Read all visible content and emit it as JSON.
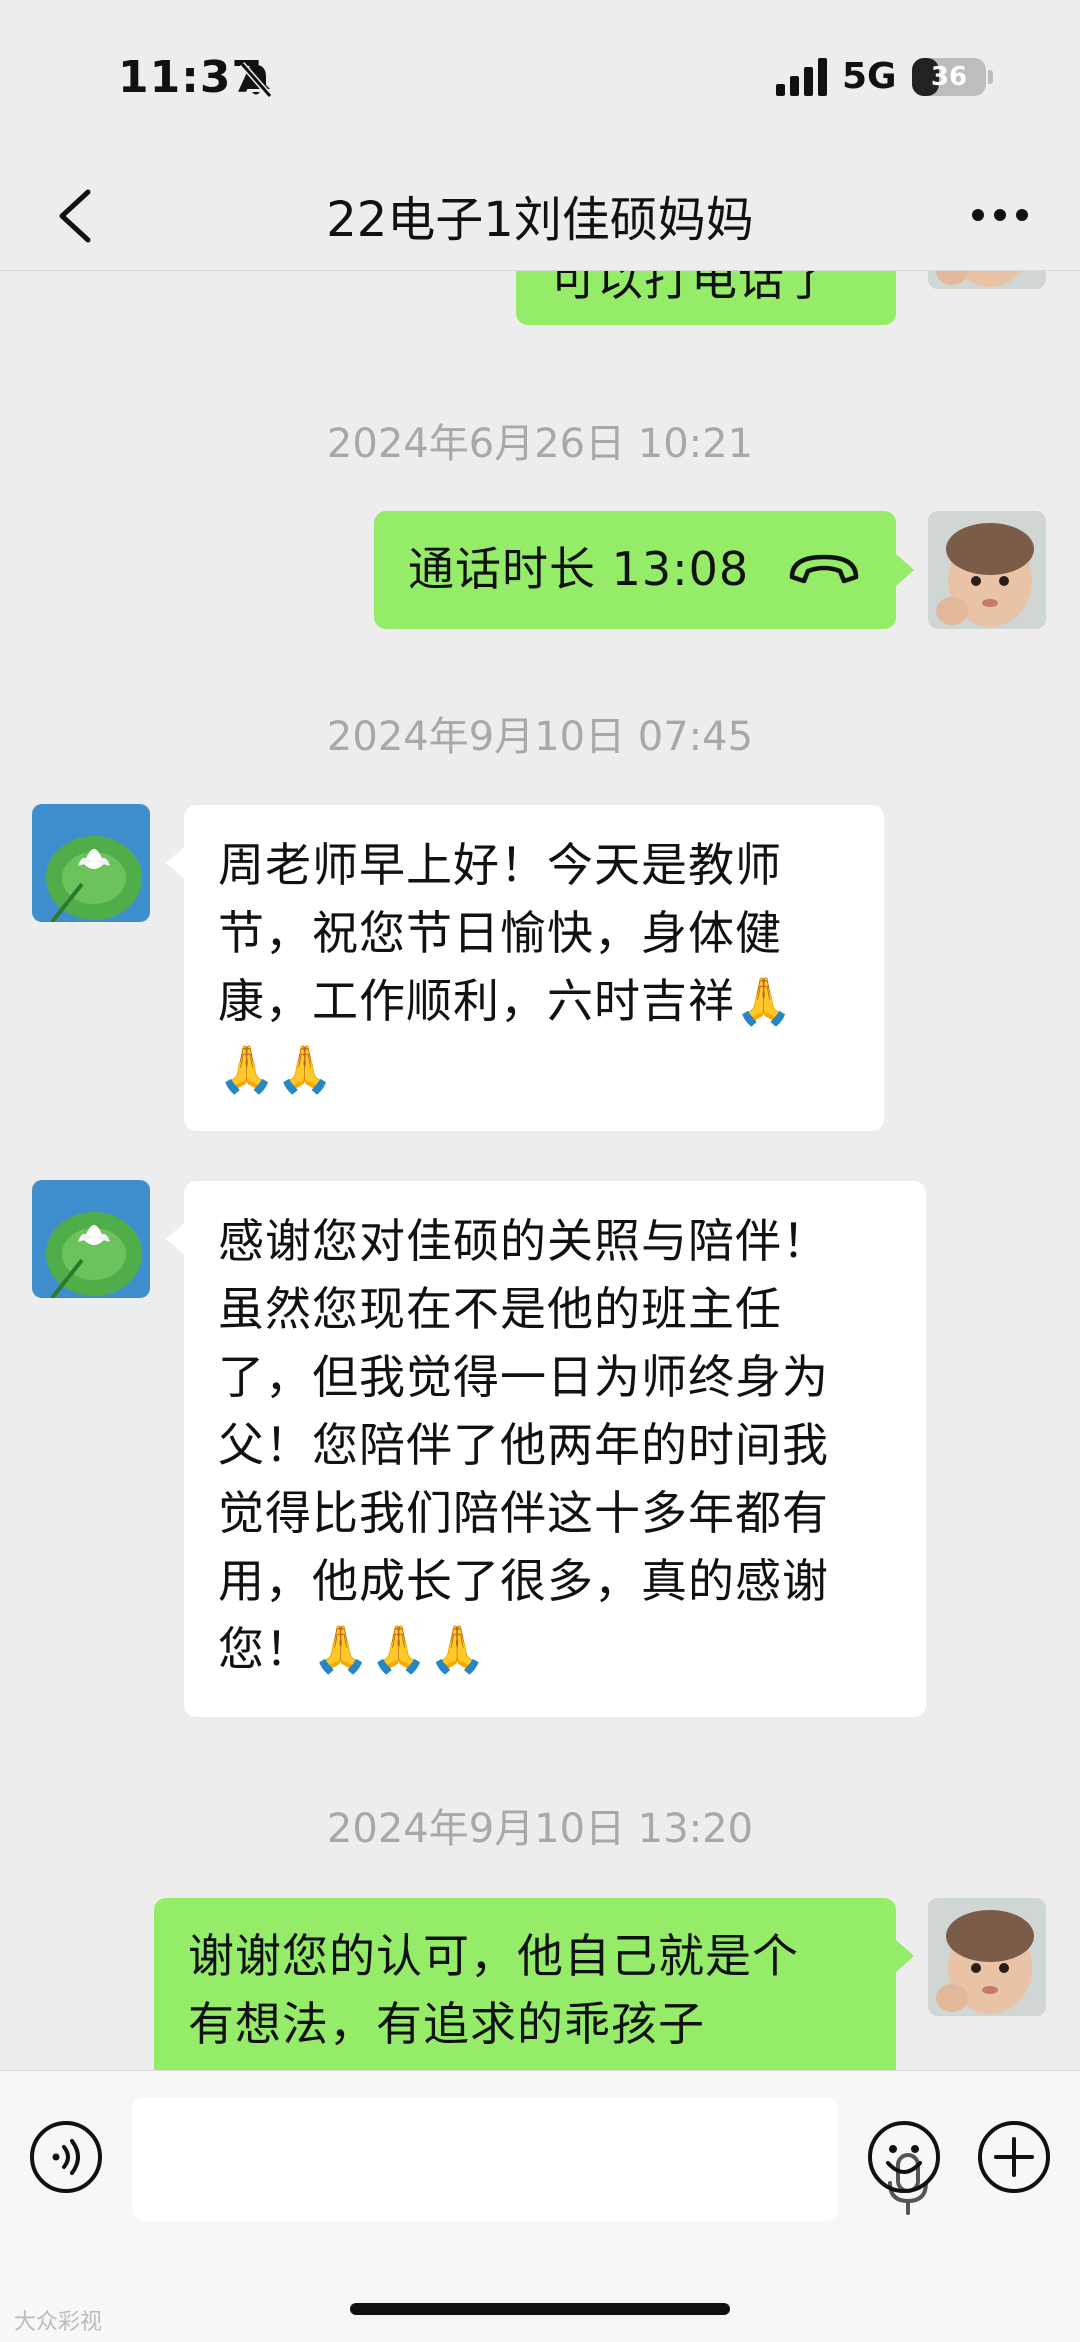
{
  "status_bar": {
    "time": "11:37",
    "network": "5G",
    "battery": "36",
    "battery_level": 0.36
  },
  "header": {
    "title": "22电子1刘佳硕妈妈"
  },
  "messages": [
    {
      "type": "text",
      "direction": "out",
      "text": "可以打电话了"
    },
    {
      "type": "timestamp",
      "text": "2024年6月26日 10:21"
    },
    {
      "type": "call",
      "direction": "out",
      "text": "通话时长 13:08"
    },
    {
      "type": "timestamp",
      "text": "2024年9月10日 07:45"
    },
    {
      "type": "text",
      "direction": "in",
      "lines": [
        "周老师早上好！今天是教师",
        "节，祝您节日愉快，身体健",
        "康，工作顺利，六时吉祥🙏",
        "🙏🙏"
      ]
    },
    {
      "type": "text",
      "direction": "in",
      "lines": [
        "感谢您对佳硕的关照与陪伴！",
        "虽然您现在不是他的班主任",
        "了，但我觉得一日为师终身为",
        "父！您陪伴了他两年的时间我",
        "觉得比我们陪伴这十多年都有",
        "用，他成长了很多，真的感谢",
        "您！🙏🙏🙏"
      ]
    },
    {
      "type": "timestamp",
      "text": "2024年9月10日 13:20"
    },
    {
      "type": "text",
      "direction": "out",
      "lines": [
        "谢谢您的认可，他自己就是个",
        "有想法，有追求的乖孩子"
      ]
    }
  ],
  "input_bar": {
    "placeholder": ""
  },
  "watermark": "大众彩视"
}
